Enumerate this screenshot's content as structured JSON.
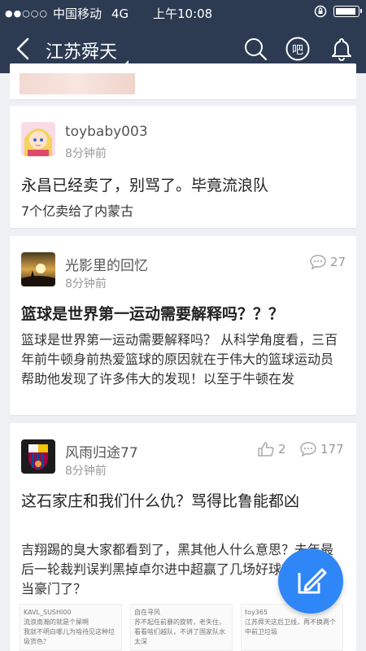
{
  "status": {
    "carrier": "中国移动",
    "network": "4G",
    "time": "上午10:08"
  },
  "nav": {
    "title": "江苏舜天",
    "bar_icon_label": "吧"
  },
  "posts": [
    {
      "user": "toybaby003",
      "time": "8分钟前",
      "title": "永昌已经卖了，别骂了。毕竟流浪队",
      "body": "7个亿卖给了内蒙古"
    },
    {
      "user": "光影里的回忆",
      "time": "8分钟前",
      "comments": "27",
      "title": "篮球是世界第一运动需要解释吗？？？",
      "body": "篮球是世界第一运动需要解释吗？ 从科学角度看，三百年前牛顿身前热爱篮球的原因就在于伟大的篮球运动员帮助他发现了许多伟大的发现！以至于牛顿在发"
    },
    {
      "user": "风雨归途77",
      "time": "8分钟前",
      "likes": "2",
      "comments": "177",
      "title": "这石家庄和我们什么仇？骂得比鲁能都凶",
      "body": "吉翔踢的臭大家都看到了，黑其他人什么意思？去年最后一轮裁判误判黑掉卓尔进中超赢了几场好球真把自己当豪门了？"
    }
  ],
  "thumbs": [
    {
      "l1": "KAVL_SUSHI00",
      "l2": "流浪南瀚的就是个屎啊",
      "l3": "我就不明白哪儿为啥待见这种垃圾货色？"
    },
    {
      "l1": "自在寻风",
      "l2": "苏不起任前暴的旋转，老失住，看看啥们越队，不讲了国家队水太深",
      "l3": ""
    },
    {
      "l1": "toy365",
      "l2": "江苏舜天这后卫线，再不换两个",
      "l3": "中前卫垃圾"
    }
  ],
  "colors": {
    "nav_bg": "#2c3a52",
    "fab": "#2f86f6"
  }
}
